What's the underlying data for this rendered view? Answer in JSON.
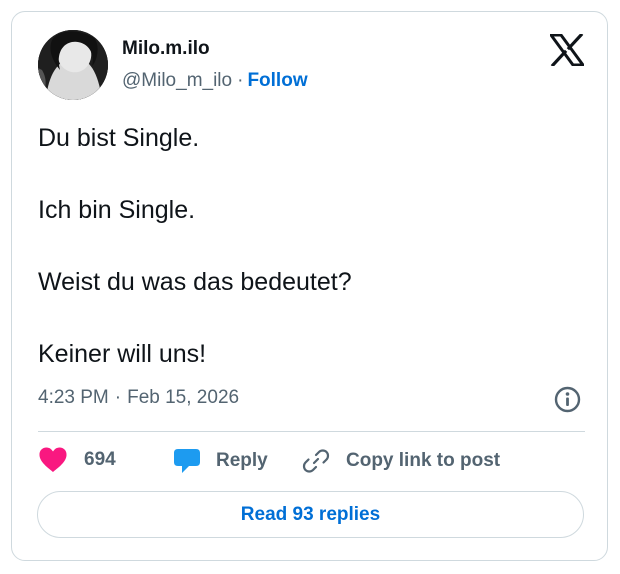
{
  "author": {
    "display_name": "Milo.m.ilo",
    "handle": "@Milo_m_ilo",
    "separator": "·",
    "follow_label": "Follow",
    "avatar_icon": "profile-photo-dark"
  },
  "brand_icon": "x-logo-icon",
  "tweet": {
    "paragraphs": [
      "Du bist Single.",
      "Ich bin Single.",
      "Weist du was das bedeutet?",
      "Keiner will uns!"
    ]
  },
  "meta": {
    "time": "4:23 PM",
    "separator": "·",
    "date": "Feb 15, 2026",
    "info_icon": "info-icon"
  },
  "actions": {
    "like_count": "694",
    "like_icon": "heart-icon",
    "reply_label": "Reply",
    "reply_icon": "speech-bubble-icon",
    "copy_label": "Copy link to post",
    "copy_icon": "link-icon"
  },
  "read_replies_label": "Read 93 replies",
  "colors": {
    "text": "#0f1419",
    "secondary": "#536471",
    "link_blue": "#006fd6",
    "like_pink": "#f91880",
    "reply_blue": "#1d9bf0",
    "border": "#cfd9de"
  }
}
